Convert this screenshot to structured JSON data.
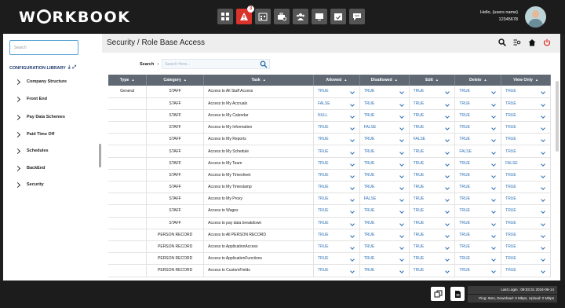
{
  "header": {
    "logo": "W RKBOOK",
    "logo_pre": "W",
    "logo_post": "RKBOOK",
    "alert_count": "3",
    "user_greeting": "Hello, {users name}",
    "user_id": "12345678"
  },
  "sidebar": {
    "search_placeholder": "Search",
    "library_title": "CONFIGURATION LIBRARY",
    "items": [
      {
        "label": "Company Structure"
      },
      {
        "label": "Front End"
      },
      {
        "label": "Pay Data Schemes"
      },
      {
        "label": "Paid Time Off"
      },
      {
        "label": "Schedules"
      },
      {
        "label": "BackEnd"
      },
      {
        "label": "Security"
      }
    ]
  },
  "main": {
    "title": "Security / Role Base Access",
    "search_label": "Search",
    "search_placeholder": "Search Here...",
    "columns": [
      "Type",
      "Category",
      "Task",
      "Allowed",
      "Disallowed",
      "Edit",
      "Delete",
      "View Only"
    ],
    "rows": [
      {
        "type": "General",
        "category": "STAFF",
        "task": "Access to All Staff Access",
        "allowed": "TRUE",
        "disallowed": "TRUE",
        "edit": "TRUE",
        "delete": "TRUE",
        "view": "TRUE"
      },
      {
        "type": "",
        "category": "STAFF",
        "task": "Access to My Accruals",
        "allowed": "FALSE",
        "disallowed": "TRUE",
        "edit": "TRUE",
        "delete": "TRUE",
        "view": "TRUE"
      },
      {
        "type": "",
        "category": "STAFF",
        "task": "Access to My Calendar",
        "allowed": "NULL",
        "disallowed": "TRUE",
        "edit": "TRUE",
        "delete": "TRUE",
        "view": "TRUE"
      },
      {
        "type": "",
        "category": "STAFF",
        "task": "Access to My Information",
        "allowed": "TRUE",
        "disallowed": "FALSE",
        "edit": "TRUE",
        "delete": "TRUE",
        "view": "TRUE"
      },
      {
        "type": "",
        "category": "STAFF",
        "task": "Access to My Reports",
        "allowed": "TRUE",
        "disallowed": "TRUE",
        "edit": "FALSE",
        "delete": "TRUE",
        "view": "TRUE"
      },
      {
        "type": "",
        "category": "STAFF",
        "task": "Access to My Schedule",
        "allowed": "TRUE",
        "disallowed": "TRUE",
        "edit": "TRUE",
        "delete": "FALSE",
        "view": "TRUE"
      },
      {
        "type": "",
        "category": "STAFF",
        "task": "Access to My Team",
        "allowed": "TRUE",
        "disallowed": "TRUE",
        "edit": "TRUE",
        "delete": "TRUE",
        "view": "FALSE"
      },
      {
        "type": "",
        "category": "STAFF",
        "task": "Access to My Timesheet",
        "allowed": "TRUE",
        "disallowed": "TRUE",
        "edit": "TRUE",
        "delete": "TRUE",
        "view": "TRUE"
      },
      {
        "type": "",
        "category": "STAFF",
        "task": "Access to My Timestamp",
        "allowed": "TRUE",
        "disallowed": "TRUE",
        "edit": "TRUE",
        "delete": "TRUE",
        "view": "TRUE"
      },
      {
        "type": "",
        "category": "STAFF",
        "task": "Access to My Proxy",
        "allowed": "TRUE",
        "disallowed": "FALSE",
        "edit": "TRUE",
        "delete": "TRUE",
        "view": "TRUE"
      },
      {
        "type": "",
        "category": "STAFF",
        "task": "Access to Wages",
        "allowed": "TRUE",
        "disallowed": "TRUE",
        "edit": "TRUE",
        "delete": "TRUE",
        "view": "TRUE"
      },
      {
        "type": "",
        "category": "STAFF",
        "task": "Access to pay data breakdown",
        "allowed": "TRUE",
        "disallowed": "TRUE",
        "edit": "TRUE",
        "delete": "TRUE",
        "view": "TRUE"
      },
      {
        "type": "",
        "category": "PERSON RECORD",
        "task": "Access to All PERSON RECORD",
        "allowed": "TRUE",
        "disallowed": "TRUE",
        "edit": "TRUE",
        "delete": "TRUE",
        "view": "TRUE"
      },
      {
        "type": "",
        "category": "PERSON RECORD",
        "task": "Access to ApplicationAccess",
        "allowed": "TRUE",
        "disallowed": "TRUE",
        "edit": "TRUE",
        "delete": "TRUE",
        "view": "TRUE"
      },
      {
        "type": "",
        "category": "PERSON RECORD",
        "task": "Access to ApplicationFunctions",
        "allowed": "TRUE",
        "disallowed": "TRUE",
        "edit": "TRUE",
        "delete": "TRUE",
        "view": "TRUE"
      },
      {
        "type": "",
        "category": "PERSON RECORD",
        "task": "Access to CustomFields",
        "allowed": "TRUE",
        "disallowed": "TRUE",
        "edit": "TRUE",
        "delete": "TRUE",
        "view": "TRUE"
      }
    ]
  },
  "footer": {
    "last_login": "Last Login : 09:03:31 2024-06-14",
    "network": "Ping: 9ms, Download: 0 Mbps, Upload: 0 Mbps"
  }
}
